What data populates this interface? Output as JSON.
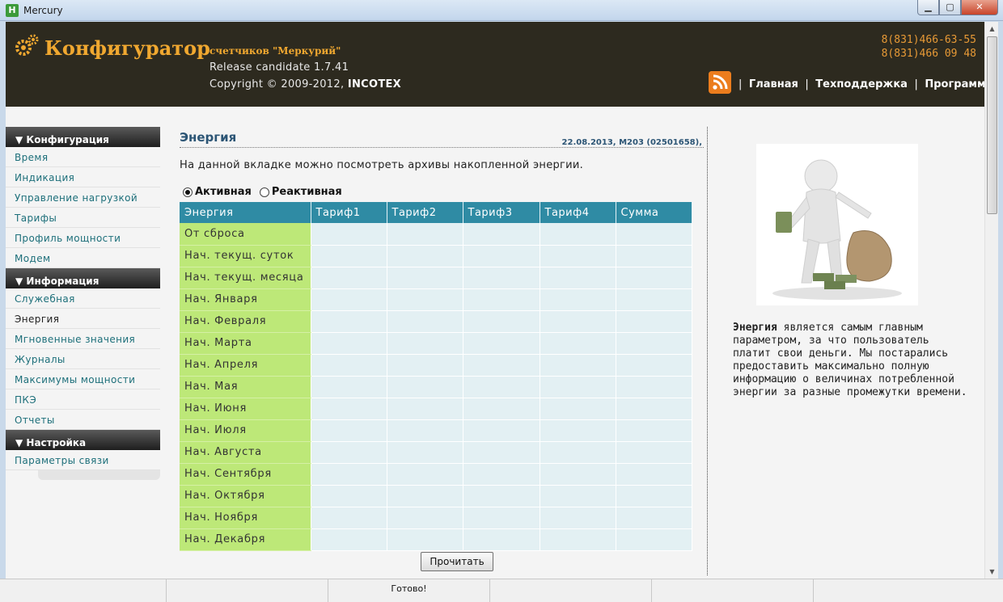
{
  "window": {
    "title": "Mercury",
    "icon_letter": "H"
  },
  "header": {
    "brand": "Конфигуратор",
    "brand_sub": "счетчиков \"Меркурий\"",
    "release": "Release candidate 1.7.41",
    "copyright": "Copyright © 2009-2012,",
    "company": "INCOTEX",
    "phone1": "8(831)466-63-55",
    "phone2": "8(831)466 09 48",
    "nav": [
      "Главная",
      "Техподдержка",
      "Программа"
    ],
    "sep": "|"
  },
  "sidebar": {
    "sections": [
      {
        "title": "▼ Конфигурация",
        "items": [
          "Время",
          "Индикация",
          "Управление нагрузкой",
          "Тарифы",
          "Профиль мощности",
          "Модем"
        ]
      },
      {
        "title": "▼ Информация",
        "items": [
          "Служебная",
          "Энергия",
          "Мгновенные значения",
          "Журналы",
          "Максимумы мощности",
          "ПКЭ",
          "Отчеты"
        ]
      },
      {
        "title": "▼ Настройка",
        "items": [
          "Параметры связи"
        ]
      }
    ],
    "active": "Энергия"
  },
  "main": {
    "title": "Энергия",
    "meta": "22.08.2013, М203 (02501658),",
    "intro": "На данной вкладке можно посмотреть архивы накопленной энергии.",
    "radio_active": "Активная",
    "radio_reactive": "Реактивная",
    "selected": "Активная",
    "columns": [
      "Энергия",
      "Тариф1",
      "Тариф2",
      "Тариф3",
      "Тариф4",
      "Сумма"
    ],
    "rows": [
      "От сброса",
      "Нач. текущ. суток",
      "Нач. текущ. месяца",
      "Нач. Января",
      "Нач. Февраля",
      "Нач. Марта",
      "Нач. Апреля",
      "Нач. Мая",
      "Нач. Июня",
      "Нач. Июля",
      "Нач. Августа",
      "Нач. Сентября",
      "Нач. Октября",
      "Нач. Ноября",
      "Нач. Декабря"
    ],
    "read_button": "Прочитать"
  },
  "aside": {
    "bold": "Энергия",
    "text": " является самым главным параметром, за что пользователь платит свои деньги. Мы постарались предоставить максимально полную информацию о величинах потребленной энергии за разные промежутки времени."
  },
  "status": {
    "text": "Готово!"
  },
  "colors": {
    "header_bg": "#2d2a1f",
    "brand": "#f0a830",
    "table_header": "#2f8ba4",
    "row_label": "#bde878",
    "cell": "#e3f0f3"
  }
}
